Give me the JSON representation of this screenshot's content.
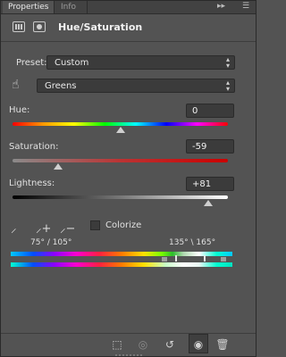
{
  "tabs": [
    {
      "label": "Properties"
    },
    {
      "label": "Info"
    }
  ],
  "panel": {
    "title": "Hue/Saturation",
    "preset": {
      "label": "Preset:",
      "value": "Custom"
    },
    "channel": {
      "value": "Greens"
    },
    "hue": {
      "label": "Hue:",
      "value": "0",
      "level": 0
    },
    "saturation": {
      "label": "Saturation:",
      "value": "-59",
      "level": -59
    },
    "lightness": {
      "label": "Lightness:",
      "value": "+81",
      "level": 81
    },
    "colorize": {
      "label": "Colorize",
      "checked": false
    },
    "range": {
      "left": "75° / 105°",
      "right": "135° \\ 165°"
    }
  },
  "icons": {
    "menu_top": "double-chevron-right-icon",
    "panel_menu": "panel-menu-icon",
    "adjustment": "hue-saturation-adjustment-icon",
    "mask": "layer-mask-icon",
    "targeted_adjust": "hand-scrubby-icon",
    "eyedropper": "eyedropper-icon",
    "eyedropper_add": "eyedropper-plus-icon",
    "eyedropper_sub": "eyedropper-minus-icon",
    "clip": "clip-to-layer-icon",
    "view_prev": "view-previous-state-icon",
    "reset": "reset-icon",
    "visibility": "eye-icon",
    "delete": "trash-icon"
  }
}
